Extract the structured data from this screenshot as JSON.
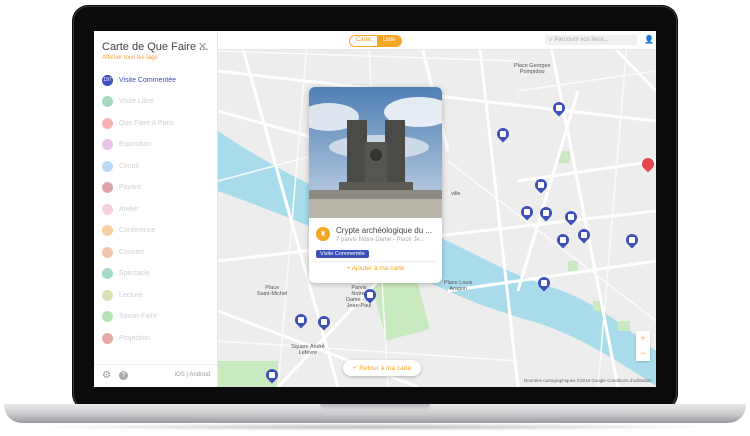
{
  "sidebar": {
    "title": "Carte de Que Faire ...",
    "show_tags": "Afficher tous les tags",
    "categories": [
      {
        "label": "Visite Commentée",
        "count": "197",
        "color": "#3e4fb8",
        "active": true
      },
      {
        "label": "Visite Libre",
        "color": "#a6d9bd"
      },
      {
        "label": "Que Faire A Paris",
        "color": "#f7b3b5"
      },
      {
        "label": "Exposition",
        "color": "#e7c3ea"
      },
      {
        "label": "Circuit",
        "color": "#b9d8f3"
      },
      {
        "label": "Payant",
        "color": "#dfa5a9"
      },
      {
        "label": "Atelier",
        "color": "#f6cfe0"
      },
      {
        "label": "Conférence",
        "color": "#f6cfa6"
      },
      {
        "label": "Concert",
        "color": "#f3c6b1"
      },
      {
        "label": "Spectacle",
        "color": "#a6d9c9"
      },
      {
        "label": "Lecture",
        "color": "#dbe2b3"
      },
      {
        "label": "Savoir-Faire",
        "color": "#b8e2b8"
      },
      {
        "label": "Projection",
        "color": "#e3aba3"
      }
    ],
    "footer": {
      "ios": "iOS",
      "separator": "|",
      "android": "Android",
      "gear_icon": "gear-icon",
      "help_icon": "help-icon"
    }
  },
  "topbar": {
    "tab_map": "Carte",
    "tab_list": "Liste",
    "search_placeholder": "Parcourir vos lieux...",
    "accent": "#f5a623"
  },
  "map": {
    "labels": {
      "pompidou": "Place Georges\nPompidou",
      "louis_aragon": "Place Louis\nAragon",
      "saint_michel": "Place\nSaint-Michel",
      "notre_dame": "Parvis\nNotre-\nDame - Pl.\nJean-Paul",
      "lefevre": "Square André\nLefevre",
      "ville": "ville"
    },
    "retour": "Retour à ma carte",
    "zoom_in": "+",
    "zoom_out": "−",
    "copyright": "Données cartographiques ©2016 Google    Conditions d'utilisation"
  },
  "popup": {
    "title": "Crypte archéologique du ...",
    "address": "7 parvis Notre-Dame - Place Je...",
    "badge": "Visite Commentée",
    "add": "Ajouter à ma carte"
  }
}
